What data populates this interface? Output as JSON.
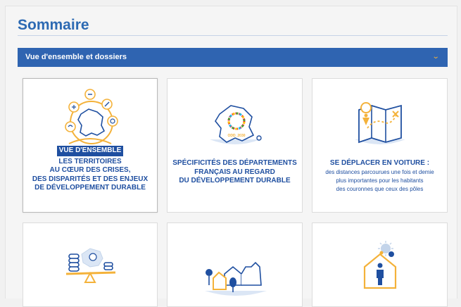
{
  "summary": {
    "title": "Sommaire"
  },
  "section": {
    "label": "Vue d'ensemble et dossiers",
    "chevron": "chevron-down-icon"
  },
  "cards": [
    {
      "tag": "VUE D'ENSEMBLE",
      "lines": [
        "LES TERRITOIRES",
        "AU CŒUR DES CRISES,",
        "DES DISPARITÉS ET DES ENJEUX",
        "DE DÉVELOPPEMENT DURABLE"
      ],
      "icon": "france-territories-icon"
    },
    {
      "lines": [
        "SPÉCIFICITÉS DES DÉPARTEMENTS",
        "FRANÇAIS AU REGARD",
        "DU DÉVELOPPEMENT DURABLE"
      ],
      "icon_text": "ODD_2030",
      "icon": "france-sdg-map-icon"
    },
    {
      "lines": [
        "SE DÉPLACER EN VOITURE :"
      ],
      "sub_lines": [
        "des distances parcourues une fois et demie",
        "plus importantes pour les habitants",
        "des couronnes que ceux des pôles"
      ],
      "icon": "road-map-icon"
    },
    {
      "icon": "balance-coins-icon"
    },
    {
      "icon": "village-landscape-icon"
    },
    {
      "icon": "virus-home-icon"
    }
  ],
  "colors": {
    "accent": "#2f64b1",
    "text_blue": "#1f4fa0",
    "yellow": "#f4b23a"
  }
}
